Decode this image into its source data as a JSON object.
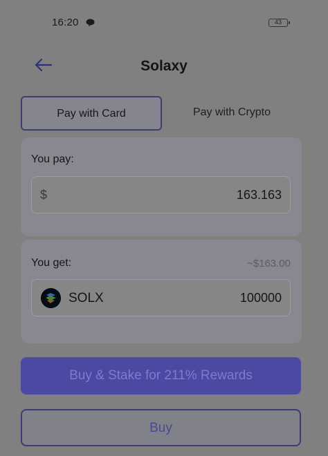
{
  "status_bar": {
    "time": "16:20",
    "battery": "43"
  },
  "header": {
    "title": "Solaxy"
  },
  "tabs": [
    {
      "label": "Pay with Card",
      "active": true
    },
    {
      "label": "Pay with Crypto",
      "active": false
    }
  ],
  "pay": {
    "label": "You pay:",
    "currency": "$",
    "amount": "163.163"
  },
  "get": {
    "label": "You get:",
    "approx": "~$163.00",
    "token": "SOLX",
    "amount": "100000"
  },
  "buttons": {
    "stake": "Buy & Stake for 211% Rewards",
    "buy": "Buy"
  },
  "colors": {
    "accent": "#4a4aa2",
    "overlay": "#808080"
  }
}
